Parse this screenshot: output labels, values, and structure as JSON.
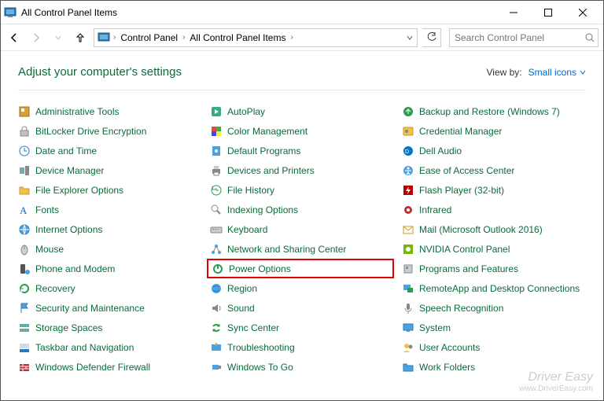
{
  "window": {
    "title": "All Control Panel Items"
  },
  "address": {
    "crumbs": [
      "Control Panel",
      "All Control Panel Items"
    ]
  },
  "search": {
    "placeholder": "Search Control Panel"
  },
  "page": {
    "heading": "Adjust your computer's settings",
    "view_by_label": "View by:",
    "view_by_value": "Small icons"
  },
  "watermark": {
    "brand": "Driver Easy",
    "url": "www.DriverEasy.com"
  },
  "columns": [
    [
      {
        "label": "Administrative Tools",
        "icon": "tools",
        "name": "item-administrative-tools"
      },
      {
        "label": "BitLocker Drive Encryption",
        "icon": "lock",
        "name": "item-bitlocker"
      },
      {
        "label": "Date and Time",
        "icon": "clock",
        "name": "item-date-time"
      },
      {
        "label": "Device Manager",
        "icon": "device",
        "name": "item-device-manager"
      },
      {
        "label": "File Explorer Options",
        "icon": "folder",
        "name": "item-file-explorer-options"
      },
      {
        "label": "Fonts",
        "icon": "font",
        "name": "item-fonts"
      },
      {
        "label": "Internet Options",
        "icon": "globe",
        "name": "item-internet-options"
      },
      {
        "label": "Mouse",
        "icon": "mouse",
        "name": "item-mouse"
      },
      {
        "label": "Phone and Modem",
        "icon": "phone",
        "name": "item-phone-modem"
      },
      {
        "label": "Recovery",
        "icon": "recovery",
        "name": "item-recovery"
      },
      {
        "label": "Security and Maintenance",
        "icon": "flag",
        "name": "item-security-maintenance"
      },
      {
        "label": "Storage Spaces",
        "icon": "storage",
        "name": "item-storage-spaces"
      },
      {
        "label": "Taskbar and Navigation",
        "icon": "taskbar",
        "name": "item-taskbar-navigation"
      },
      {
        "label": "Windows Defender Firewall",
        "icon": "firewall",
        "name": "item-firewall"
      }
    ],
    [
      {
        "label": "AutoPlay",
        "icon": "autoplay",
        "name": "item-autoplay"
      },
      {
        "label": "Color Management",
        "icon": "color",
        "name": "item-color-management"
      },
      {
        "label": "Default Programs",
        "icon": "defaults",
        "name": "item-default-programs"
      },
      {
        "label": "Devices and Printers",
        "icon": "printers",
        "name": "item-devices-printers"
      },
      {
        "label": "File History",
        "icon": "history",
        "name": "item-file-history"
      },
      {
        "label": "Indexing Options",
        "icon": "index",
        "name": "item-indexing-options"
      },
      {
        "label": "Keyboard",
        "icon": "keyboard",
        "name": "item-keyboard"
      },
      {
        "label": "Network and Sharing Center",
        "icon": "network",
        "name": "item-network-sharing"
      },
      {
        "label": "Power Options",
        "icon": "power",
        "name": "item-power-options",
        "highlighted": true
      },
      {
        "label": "Region",
        "icon": "region",
        "name": "item-region"
      },
      {
        "label": "Sound",
        "icon": "sound",
        "name": "item-sound"
      },
      {
        "label": "Sync Center",
        "icon": "sync",
        "name": "item-sync-center"
      },
      {
        "label": "Troubleshooting",
        "icon": "troubleshoot",
        "name": "item-troubleshooting"
      },
      {
        "label": "Windows To Go",
        "icon": "togo",
        "name": "item-windows-to-go"
      }
    ],
    [
      {
        "label": "Backup and Restore (Windows 7)",
        "icon": "backup",
        "name": "item-backup-restore"
      },
      {
        "label": "Credential Manager",
        "icon": "credential",
        "name": "item-credential-manager"
      },
      {
        "label": "Dell Audio",
        "icon": "dell",
        "name": "item-dell-audio"
      },
      {
        "label": "Ease of Access Center",
        "icon": "ease",
        "name": "item-ease-of-access"
      },
      {
        "label": "Flash Player (32-bit)",
        "icon": "flash",
        "name": "item-flash-player"
      },
      {
        "label": "Infrared",
        "icon": "infrared",
        "name": "item-infrared"
      },
      {
        "label": "Mail (Microsoft Outlook 2016)",
        "icon": "mail",
        "name": "item-mail"
      },
      {
        "label": "NVIDIA Control Panel",
        "icon": "nvidia",
        "name": "item-nvidia"
      },
      {
        "label": "Programs and Features",
        "icon": "programs",
        "name": "item-programs-features"
      },
      {
        "label": "RemoteApp and Desktop Connections",
        "icon": "remote",
        "name": "item-remoteapp"
      },
      {
        "label": "Speech Recognition",
        "icon": "speech",
        "name": "item-speech-recognition"
      },
      {
        "label": "System",
        "icon": "system",
        "name": "item-system"
      },
      {
        "label": "User Accounts",
        "icon": "users",
        "name": "item-user-accounts"
      },
      {
        "label": "Work Folders",
        "icon": "workfolders",
        "name": "item-work-folders"
      }
    ]
  ],
  "icons_svg": {
    "tools": "<rect x='2' y='2' width='12' height='12' fill='#d8a038' stroke='#a07020'/><rect x='4' y='4' width='4' height='4' fill='#fff'/>",
    "lock": "<rect x='3' y='7' width='10' height='7' fill='#c0c0c0' stroke='#888'/><path d='M5 7 V5 a3 3 0 0 1 6 0 V7' fill='none' stroke='#888'/>",
    "clock": "<circle cx='8' cy='8' r='6' fill='#fff' stroke='#2a7ab8'/><path d='M8 4 V8 H11' stroke='#2a7ab8' fill='none'/>",
    "device": "<rect x='2' y='4' width='6' height='8' fill='#7aa' /><rect x='9' y='2' width='5' height='12' fill='#888'/>",
    "folder": "<path d='M2 4 h4 l1 2 h7 v7 h-12 z' fill='#f3c14b' stroke='#c89a2b'/>",
    "font": "<text x='2' y='13' font-size='13' font-family='serif' fill='#1565c0'>A</text>",
    "globe": "<circle cx='8' cy='8' r='6' fill='#4aa3e0' stroke='#2a7ab8'/><path d='M2 8 h12 M8 2 a8 12 0 0 1 0 12 a8 12 0 0 1 0 -12' stroke='#fff' fill='none'/>",
    "mouse": "<ellipse cx='8' cy='9' rx='4' ry='6' fill='#d0d0d0' stroke='#888'/><line x1='8' y1='3' x2='8' y2='8' stroke='#888'/>",
    "phone": "<rect x='3' y='2' width='6' height='12' rx='1' fill='#555'/><circle cx='12' cy='12' r='3' fill='#4aa3e0'/>",
    "recovery": "<path d='M3 8 a5 5 0 1 1 2 4' fill='none' stroke='#2a9d4e' stroke-width='2'/><path d='M3 12 L3 8 L7 8' fill='none' stroke='#2a9d4e'/>",
    "flag": "<path d='M4 2 v12 M4 2 h8 l-2 3 l2 3 h-8' fill='#4aa3e0' stroke='#2a7ab8'/>",
    "storage": "<rect x='2' y='3' width='12' height='4' fill='#6aa' /><rect x='2' y='9' width='12' height='4' fill='#6aa'/>",
    "taskbar": "<rect x='2' y='10' width='12' height='4' fill='#2a7ab8'/><rect x='2' y='3' width='12' height='6' fill='#cde'/>",
    "firewall": "<rect x='2' y='4' width='12' height='9' fill='#b33'/><path d='M2 7 h12 M2 10 h12 M6 4 v3 M10 7 v3 M6 10 v3' stroke='#fff'/>",
    "autoplay": "<rect x='2' y='2' width='12' height='12' rx='2' fill='#3a8'/><path d='M6 5 v6 l5 -3 z' fill='#fff'/>",
    "color": "<rect x='2' y='2' width='6' height='6' fill='#e44'/><rect x='8' y='2' width='6' height='6' fill='#4a4'/><rect x='2' y='8' width='6' height='6' fill='#44e'/><rect x='8' y='8' width='6' height='6' fill='#ee4'/>",
    "defaults": "<rect x='3' y='2' width='10' height='12' fill='#4aa3e0'/><circle cx='8' cy='8' r='2' fill='#fff'/>",
    "printers": "<rect x='3' y='6' width='10' height='6' fill='#888'/><rect x='5' y='2' width='6' height='4' fill='#ccc'/><rect x='5' y='10' width='6' height='4' fill='#fff' stroke='#888'/>",
    "history": "<circle cx='8' cy='8' r='6' fill='none' stroke='#2a9d4e'/><path d='M8 5 V8 H11' stroke='#2a9d4e' fill='none'/><path d='M3 3 v4 h4' fill='none' stroke='#2a9d4e'/>",
    "index": "<circle cx='6' cy='6' r='4' fill='none' stroke='#888'/><line x1='9' y1='9' x2='13' y2='13' stroke='#888' stroke-width='2'/>",
    "keyboard": "<rect x='1' y='5' width='14' height='7' rx='1' fill='#ccc' stroke='#888'/><rect x='3' y='7' width='2' height='1' fill='#888'/><rect x='6' y='7' width='2' height='1' fill='#888'/><rect x='9' y='7' width='2' height='1' fill='#888'/>",
    "network": "<circle cx='4' cy='12' r='2' fill='#4aa3e0'/><circle cx='12' cy='12' r='2' fill='#4aa3e0'/><circle cx='8' cy='4' r='2' fill='#4aa3e0'/><path d='M8 4 L4 12 M8 4 L12 12' stroke='#888'/>",
    "power": "<circle cx='8' cy='8' r='6' fill='#2a9d4e'/><circle cx='8' cy='8' r='4' fill='#fff'/><path d='M8 4 v4' stroke='#2a9d4e' stroke-width='2'/>",
    "region": "<circle cx='8' cy='8' r='6' fill='#4aa3e0'/><path d='M4 6 q4 -3 8 0 M4 10 q4 3 8 0' stroke='#2a7ab8' fill='none'/>",
    "sound": "<path d='M3 6 h3 l4 -3 v10 l-4 -3 h-3 z' fill='#888'/><path d='M12 5 q2 3 0 6' stroke='#888' fill='none'/>",
    "sync": "<path d='M4 6 a5 5 0 0 1 8 0 M12 10 a5 5 0 0 1 -8 0' fill='none' stroke='#2a9d4e' stroke-width='2'/><path d='M12 3 v3 h-3 M4 13 v-3 h3' fill='none' stroke='#2a9d4e'/>",
    "troubleshoot": "<rect x='2' y='4' width='12' height='8' fill='#4aa3e0'/><path d='M7 2 l2 2 l-2 2' fill='#f3c14b' stroke='#c89a2b'/>",
    "togo": "<rect x='3' y='5' width='8' height='6' fill='#4aa3e0'/><rect x='11' y='6' width='3' height='4' fill='#888'/>",
    "backup": "<circle cx='8' cy='8' r='6' fill='#2a9d4e'/><path d='M8 11 V5 M5 8 l3 -3 l3 3' stroke='#fff' fill='none'/>",
    "credential": "<rect x='2' y='3' width='12' height='10' rx='1' fill='#f3c14b' stroke='#c89a2b'/><circle cx='6' cy='8' r='2' fill='#888'/>",
    "dell": "<circle cx='8' cy='8' r='6' fill='#0076ce'/><text x='4' y='11' font-size='7' fill='#fff'>D</text>",
    "ease": "<circle cx='8' cy='8' r='6' fill='#4aa3e0'/><circle cx='8' cy='5' r='1.5' fill='#fff'/><path d='M4 8 h8 M8 8 v5 M6 13 l2 -3 l2 3' stroke='#fff' fill='none'/>",
    "flash": "<rect x='2' y='2' width='12' height='12' fill='#b00'/><path d='M9 3 L5 9 h3 l-1 4 l4 -6 h-3 z' fill='#fff'/>",
    "infrared": "<circle cx='8' cy='8' r='5' fill='#b33'/><circle cx='8' cy='8' r='2' fill='#fff'/>",
    "mail": "<rect x='2' y='4' width='12' height='9' fill='#fff' stroke='#c89a2b'/><path d='M2 4 l6 5 l6 -5' stroke='#c89a2b' fill='none'/>",
    "nvidia": "<rect x='2' y='2' width='12' height='12' fill='#76b900'/><circle cx='8' cy='8' r='3' fill='#fff'/>",
    "programs": "<rect x='3' y='3' width='10' height='10' fill='#ccc' stroke='#888'/><rect x='5' y='5' width='3' height='3' fill='#4aa3e0'/>",
    "remote": "<rect x='2' y='3' width='9' height='7' fill='#4aa3e0'/><rect x='7' y='7' width='7' height='6' fill='#2a9d4e'/>",
    "speech": "<rect x='6' y='2' width='4' height='8' rx='2' fill='#888'/><path d='M4 8 a4 4 0 0 0 8 0 M8 12 v3' stroke='#888' fill='none'/>",
    "system": "<rect x='2' y='3' width='12' height='8' fill='#4aa3e0' stroke='#2a7ab8'/><rect x='6' y='11' width='4' height='2' fill='#888'/>",
    "users": "<circle cx='6' cy='6' r='3' fill='#f3c14b'/><circle cx='11' cy='7' r='2.5' fill='#888'/><path d='M2 14 q4 -4 8 0' fill='#f3c14b'/>",
    "workfolders": "<path d='M2 4 h4 l1 2 h7 v7 h-12 z' fill='#4aa3e0' stroke='#2a7ab8'/>"
  }
}
